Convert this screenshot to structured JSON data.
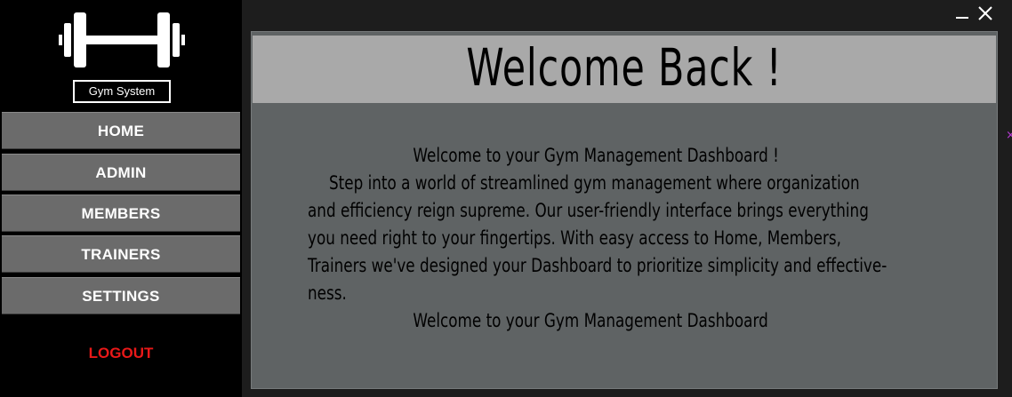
{
  "sidebar": {
    "app_name": "Gym System",
    "logo_icon": "dumbbell-icon",
    "nav": [
      {
        "label": "HOME"
      },
      {
        "label": "ADMIN"
      },
      {
        "label": "MEMBERS"
      },
      {
        "label": "TRAINERS"
      },
      {
        "label": "SETTINGS"
      }
    ],
    "logout_label": "LOGOUT",
    "logout_color": "#e81818"
  },
  "window": {
    "minimize_icon": "minimize-icon",
    "close_icon": "close-icon"
  },
  "main": {
    "title": "Welcome Back !",
    "lines": [
      "Welcome to your Gym Management Dashboard !",
      "Step into a world of streamlined gym management where organization",
      "and efficiency reign supreme. Our user-friendly interface brings everything",
      "you need right to your fingertips. With easy access to Home, Members,",
      "Trainers we've designed your Dashboard to prioritize simplicity and effective-",
      "ness.",
      "Welcome to your Gym Management Dashboard"
    ]
  },
  "colors": {
    "sidebar_bg": "#000000",
    "nav_button_bg": "#6b6b6b",
    "banner_bg": "#a9a9a9",
    "panel_bg": "#5f6364"
  }
}
